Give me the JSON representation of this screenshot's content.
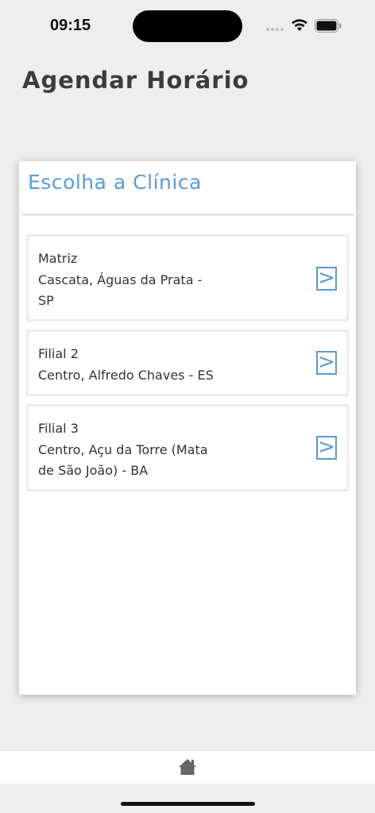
{
  "status_bar": {
    "time": "09:15"
  },
  "header": {
    "title": "Agendar Horário"
  },
  "card": {
    "title": "Escolha a Clínica",
    "clinics": [
      {
        "lines": [
          "Matriz",
          "Cascata, Águas da Prata -",
          "SP"
        ],
        "arrow": ">"
      },
      {
        "lines": [
          "Filial 2",
          "Centro, Alfredo Chaves - ES"
        ],
        "arrow": ">"
      },
      {
        "lines": [
          "Filial 3",
          "Centro, Açu da Torre (Mata",
          "de São João) - BA"
        ],
        "arrow": ">"
      }
    ]
  },
  "icons": {
    "wifi": "wifi-icon",
    "battery": "battery-icon",
    "home": "home-icon"
  },
  "colors": {
    "accent": "#5b9bd5",
    "background": "#eeeeee",
    "card": "#ffffff"
  }
}
